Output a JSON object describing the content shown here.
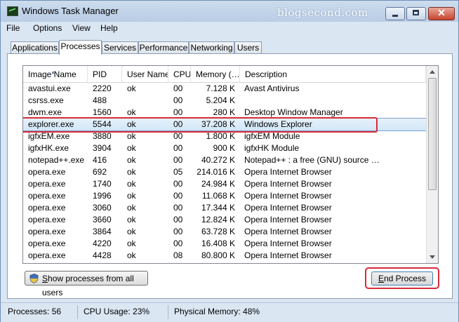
{
  "window": {
    "title": "Windows Task Manager",
    "watermark": "blogsecond.com"
  },
  "menu": [
    "File",
    "Options",
    "View",
    "Help"
  ],
  "tabs": [
    {
      "label": "Applications",
      "active": false
    },
    {
      "label": "Processes",
      "active": true
    },
    {
      "label": "Services",
      "active": false
    },
    {
      "label": "Performance",
      "active": false
    },
    {
      "label": "Networking",
      "active": false
    },
    {
      "label": "Users",
      "active": false
    }
  ],
  "columns": [
    "Image Name",
    "PID",
    "User Name",
    "CPU",
    "Memory (…",
    "Description"
  ],
  "processes": [
    {
      "name": "avastui.exe",
      "pid": "2220",
      "user": "ok",
      "cpu": "00",
      "memory": "7.128 K",
      "description": "Avast Antivirus"
    },
    {
      "name": "csrss.exe",
      "pid": "488",
      "user": "",
      "cpu": "00",
      "memory": "5.204 K",
      "description": ""
    },
    {
      "name": "dwm.exe",
      "pid": "1560",
      "user": "ok",
      "cpu": "00",
      "memory": "280 K",
      "description": "Desktop Window Manager"
    },
    {
      "name": "explorer.exe",
      "pid": "5544",
      "user": "ok",
      "cpu": "00",
      "memory": "37.208 K",
      "description": "Windows Explorer",
      "selected": true
    },
    {
      "name": "igfxEM.exe",
      "pid": "3880",
      "user": "ok",
      "cpu": "00",
      "memory": "1.800 K",
      "description": "igfxEM Module"
    },
    {
      "name": "igfxHK.exe",
      "pid": "3904",
      "user": "ok",
      "cpu": "00",
      "memory": "900 K",
      "description": "igfxHK Module"
    },
    {
      "name": "notepad++.exe",
      "pid": "416",
      "user": "ok",
      "cpu": "00",
      "memory": "40.272 K",
      "description": "Notepad++ : a free (GNU) source …"
    },
    {
      "name": "opera.exe",
      "pid": "692",
      "user": "ok",
      "cpu": "05",
      "memory": "214.016 K",
      "description": "Opera Internet Browser"
    },
    {
      "name": "opera.exe",
      "pid": "1740",
      "user": "ok",
      "cpu": "00",
      "memory": "24.984 K",
      "description": "Opera Internet Browser"
    },
    {
      "name": "opera.exe",
      "pid": "1996",
      "user": "ok",
      "cpu": "00",
      "memory": "11.068 K",
      "description": "Opera Internet Browser"
    },
    {
      "name": "opera.exe",
      "pid": "3060",
      "user": "ok",
      "cpu": "00",
      "memory": "17.344 K",
      "description": "Opera Internet Browser"
    },
    {
      "name": "opera.exe",
      "pid": "3660",
      "user": "ok",
      "cpu": "00",
      "memory": "12.824 K",
      "description": "Opera Internet Browser"
    },
    {
      "name": "opera.exe",
      "pid": "3864",
      "user": "ok",
      "cpu": "00",
      "memory": "63.728 K",
      "description": "Opera Internet Browser"
    },
    {
      "name": "opera.exe",
      "pid": "4220",
      "user": "ok",
      "cpu": "00",
      "memory": "16.408 K",
      "description": "Opera Internet Browser"
    },
    {
      "name": "opera.exe",
      "pid": "4428",
      "user": "ok",
      "cpu": "08",
      "memory": "80.800 K",
      "description": "Opera Internet Browser"
    }
  ],
  "buttons": {
    "show_all": "Show processes from all users",
    "end_process": "End Process"
  },
  "status": {
    "processes": "Processes: 56",
    "cpu": "CPU Usage: 23%",
    "memory": "Physical Memory: 48%"
  },
  "colors": {
    "highlight": "#d62b3c",
    "selection": "#d1e6f7",
    "chrome": "#dbe6f3"
  }
}
